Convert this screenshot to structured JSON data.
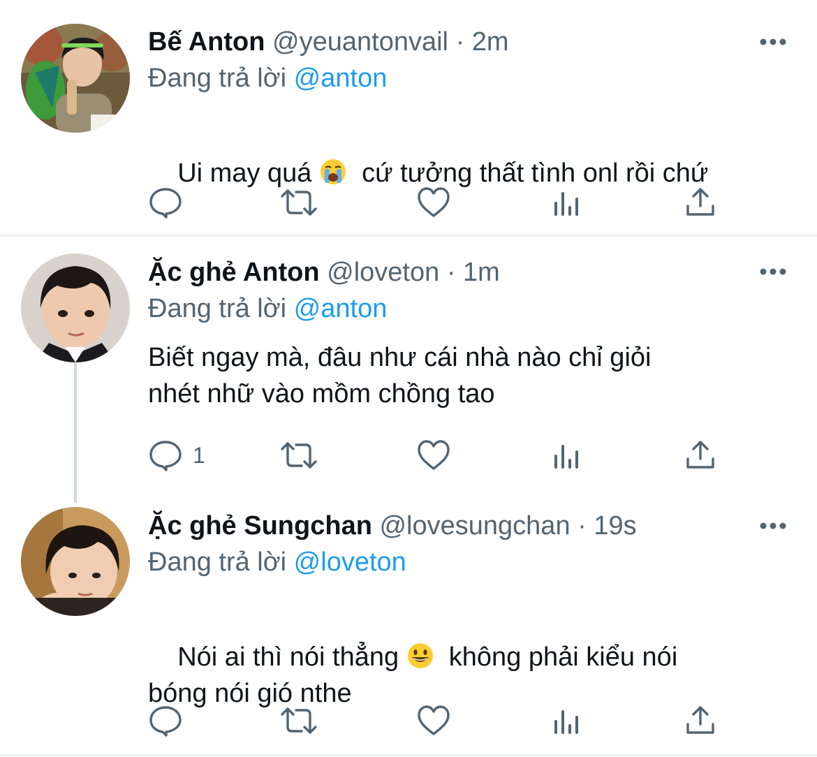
{
  "tweets": [
    {
      "display_name": "Bế Anton",
      "handle": "@yeuantonvail",
      "separator": "·",
      "time": "2m",
      "replying_prefix": "Đang trả lời",
      "replying_to": "@anton",
      "text_before_emoji": "Ui may quá ",
      "emoji": "loudly-crying-face",
      "text_after_emoji": "  cứ tưởng thất tình onl rồi chứ",
      "reply_count": ""
    },
    {
      "display_name": "Ặc ghẻ Anton",
      "handle": "@loveton",
      "separator": "·",
      "time": "1m",
      "replying_prefix": "Đang trả lời",
      "replying_to": "@anton",
      "text": "Biết ngay mà, đâu như cái nhà nào chỉ giỏi\nnhét nhữ vào mồm chồng tao",
      "reply_count": "1"
    },
    {
      "display_name": "Ặc ghẻ Sungchan",
      "handle": "@lovesungchan",
      "separator": "·",
      "time": "19s",
      "replying_prefix": "Đang trả lời",
      "replying_to": "@loveton",
      "text_before_emoji": "Nói ai thì nói thẳng ",
      "emoji": "grinning-face",
      "text_after_emoji": "  không phải kiểu nói\nbóng nói gió nthe",
      "reply_count": ""
    }
  ],
  "icons": {
    "reply": "reply-icon",
    "retweet": "retweet-icon",
    "like": "heart-icon",
    "analytics": "analytics-icon",
    "share": "share-icon",
    "more": "more-icon"
  },
  "colors": {
    "text": "#0f1419",
    "secondary": "#536471",
    "link": "#1d9bf0",
    "divider": "#eff3f4",
    "thread_line": "#cfd9de"
  }
}
